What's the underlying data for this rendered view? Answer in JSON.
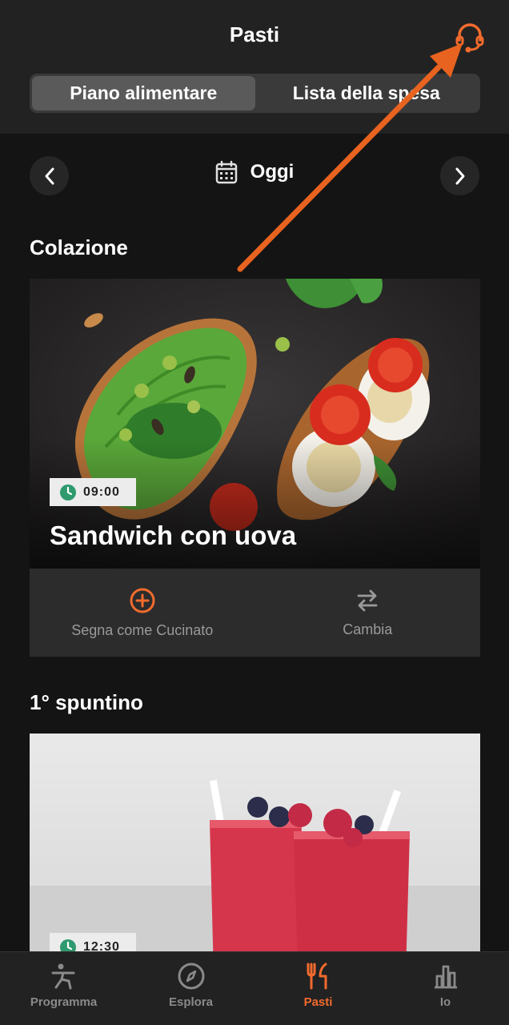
{
  "header": {
    "title": "Pasti",
    "support_icon": "headset-icon",
    "accent_color": "#f26b2d"
  },
  "segmented": {
    "options": [
      "Piano alimentare",
      "Lista della spesa"
    ],
    "selected": "Piano alimentare"
  },
  "date_nav": {
    "prev_icon": "chevron-left-icon",
    "next_icon": "chevron-right-icon",
    "calendar_icon": "calendar-icon",
    "label": "Oggi"
  },
  "meals": [
    {
      "section": "Colazione",
      "time": "09:00",
      "name": "Sandwich con uova",
      "actions": {
        "cooked_label": "Segna come Cucinato",
        "cooked_icon": "plus-circle-icon",
        "swap_label": "Cambia",
        "swap_icon": "swap-arrows-icon"
      }
    },
    {
      "section": "1° spuntino",
      "time": "12:30"
    }
  ],
  "tabbar": {
    "items": [
      {
        "label": "Programma",
        "icon": "workout-figure-icon"
      },
      {
        "label": "Esplora",
        "icon": "compass-icon"
      },
      {
        "label": "Pasti",
        "icon": "fork-knife-icon"
      },
      {
        "label": "Io",
        "icon": "bar-chart-icon"
      }
    ],
    "active": "Pasti"
  },
  "annotation": {
    "type": "arrow",
    "color": "#e8631f"
  }
}
